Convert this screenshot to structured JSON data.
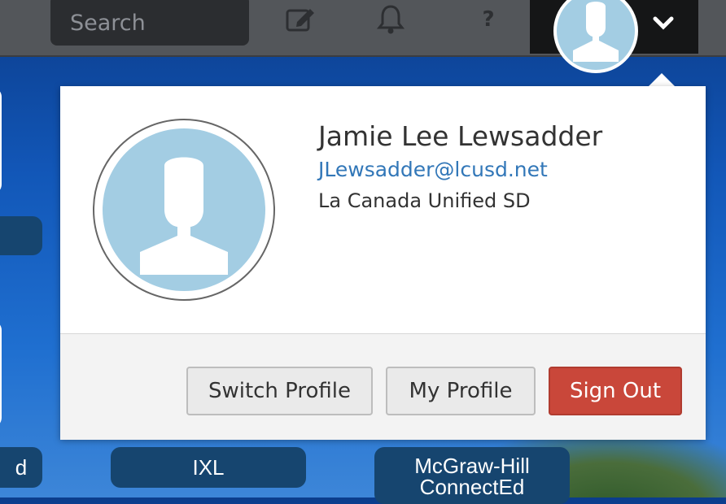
{
  "topbar": {
    "search": {
      "placeholder": "Search",
      "value": ""
    },
    "icons": {
      "edit": "edit-icon",
      "notifications": "bell-icon",
      "help": "help-icon",
      "menu": "chevron-down-icon"
    },
    "help_glyph": "?"
  },
  "tiles": [
    {
      "label": "d"
    },
    {
      "label": "IXL"
    },
    {
      "label_line1": "McGraw-Hill",
      "label_line2": "ConnectEd"
    }
  ],
  "profile": {
    "name": "Jamie Lee Lewsadder",
    "email": "JLewsadder@lcusd.net",
    "organization": "La Canada Unified SD",
    "avatar_icon": "user-silhouette-icon"
  },
  "actions": {
    "switch_profile": "Switch Profile",
    "my_profile": "My Profile",
    "sign_out": "Sign Out"
  },
  "colors": {
    "topbar": "#53565a",
    "avatar_bg": "#a3cde3",
    "link": "#3277b8",
    "danger": "#c9473a",
    "tile_label": "#16456f"
  }
}
